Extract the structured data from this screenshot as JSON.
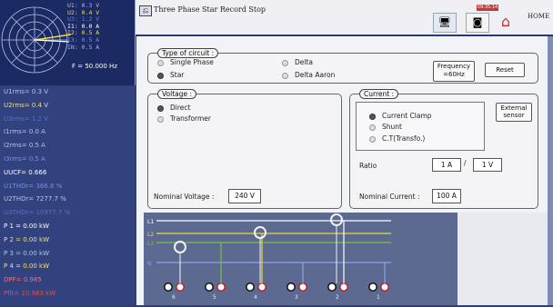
{
  "phasor": {
    "readouts": [
      {
        "text": "U1: 0.3  V",
        "color": "#b6bde6"
      },
      {
        "text": "U2: 0.4  V",
        "color": "#e8dc6a"
      },
      {
        "text": "U3: 1.2  V",
        "color": "#6c7fd0"
      },
      {
        "text": "I1: 0.0  A",
        "color": "#ffffff"
      },
      {
        "text": "I2: 0.5  A",
        "color": "#e8dc6a"
      },
      {
        "text": "I3: 0.5  A",
        "color": "#7b8fe2"
      },
      {
        "text": "IN: 0.5  A",
        "color": "#a7b2e2"
      }
    ],
    "frequency": "F = 50.000 Hz"
  },
  "measurements": [
    {
      "text": "U1rms= 0.3  V",
      "color": "#b9c1ea"
    },
    {
      "text": "U2rms= 0.4  V",
      "color": "#f0e070"
    },
    {
      "text": "U3rms= 1.2  V",
      "color": "#5b6fc8"
    },
    {
      "text": "I1rms= 0.0  A",
      "color": "#b9c1ea"
    },
    {
      "text": "I2rms= 0.5  A",
      "color": "#b9c1ea"
    },
    {
      "text": "I3rms= 0.5  A",
      "color": "#7b8fe2"
    },
    {
      "text": "UUCF= 0.666",
      "color": "#ffffff"
    },
    {
      "text": "U1THDr= 366.8  %",
      "color": "#7b8fe2"
    },
    {
      "text": "U2THDr= 7277.7  %",
      "color": "#b9c1ea"
    },
    {
      "text": "U3THDr= 10977.7  %",
      "color": "#5b6fc8"
    },
    {
      "text": "P 1 = 0.00  kW",
      "color": "#ffffff"
    },
    {
      "text": "P 2 = 0.00  kW",
      "color": "#f0e070"
    },
    {
      "text": "P 3 = 0.00  kW",
      "color": "#b9c1ea"
    },
    {
      "text": "P 4 = 0.00  kW",
      "color": "#f0e070"
    },
    {
      "text": "DPF= 0.985",
      "color": "#ff7070"
    },
    {
      "text": "Pflt= 10.983  kW",
      "color": "#e05050"
    }
  ],
  "topbar": {
    "title": "Three Phase Star Record Stop",
    "clock": "09:35:14",
    "home_label": "HOME",
    "back_icon": "back-arrow-icon"
  },
  "circuit": {
    "title": "Type of circuit :",
    "options": [
      {
        "label": "Single Phase",
        "selected": false
      },
      {
        "label": "Delta",
        "selected": false
      },
      {
        "label": "Star",
        "selected": true
      },
      {
        "label": "Delta Aaron",
        "selected": false
      }
    ],
    "frequency_btn": [
      "Frequency",
      "=60Hz"
    ],
    "reset_btn": "Reset"
  },
  "voltage": {
    "title": "Voltage :",
    "options": [
      {
        "label": "Direct",
        "selected": true
      },
      {
        "label": "Transformer",
        "selected": false
      }
    ],
    "nominal_label": "Nominal Voltage :",
    "nominal_value": "240 V"
  },
  "current": {
    "title": "Current   :",
    "options": [
      {
        "label": "Current Clamp",
        "selected": true
      },
      {
        "label": "Shunt",
        "selected": false
      },
      {
        "label": "C.T(Transfo.)",
        "selected": false
      }
    ],
    "external_btn": [
      "External",
      "sensor"
    ],
    "ratio_label": "Ratio",
    "ratio_primary": "1 A",
    "ratio_separator": "/",
    "ratio_secondary": "1 V",
    "nominal_label": "Nominal Current :",
    "nominal_value": "100 A"
  },
  "diagram": {
    "lines": [
      {
        "label": "L1",
        "color": "#ffffff"
      },
      {
        "label": "L2",
        "color": "#e8dc40"
      },
      {
        "label": "L3",
        "color": "#7ac043"
      },
      {
        "label": "N",
        "color": "#8fa0e8"
      }
    ],
    "terminal_numbers": [
      "6",
      "5",
      "4",
      "3",
      "2",
      "1"
    ]
  }
}
